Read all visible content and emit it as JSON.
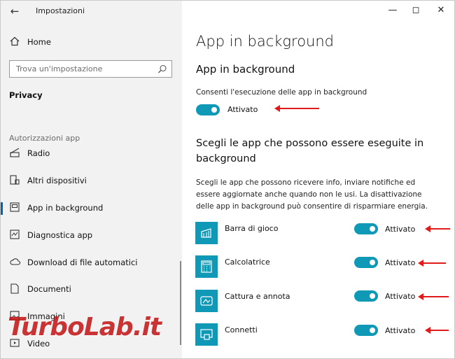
{
  "window": {
    "title": "Impostazioni",
    "minimize_icon": "minimize-icon",
    "maximize_icon": "maximize-icon",
    "close_icon": "close-icon"
  },
  "sidebar": {
    "home": {
      "label": "Home",
      "icon": "home-icon"
    },
    "search": {
      "placeholder": "Trova un'impostazione",
      "icon": "search-icon"
    },
    "section": "Privacy",
    "group_label": "Autorizzazioni app",
    "items": [
      {
        "label": "Radio",
        "icon": "radio-icon"
      },
      {
        "label": "Altri dispositivi",
        "icon": "devices-icon"
      },
      {
        "label": "App in background",
        "icon": "background-apps-icon",
        "active": true
      },
      {
        "label": "Diagnostica app",
        "icon": "diagnostics-icon"
      },
      {
        "label": "Download di file automatici",
        "icon": "cloud-icon"
      },
      {
        "label": "Documenti",
        "icon": "document-icon"
      },
      {
        "label": "Immagini",
        "icon": "image-icon"
      },
      {
        "label": "Video",
        "icon": "video-icon"
      }
    ]
  },
  "main": {
    "page_title": "App in background",
    "section_title": "App in background",
    "allow_label": "Consenti l'esecuzione delle app in background",
    "allow_toggle": {
      "state": "Attivato",
      "on": true
    },
    "choose_title": "Scegli le app che possono essere eseguite in background",
    "choose_desc": "Scegli le app che possono ricevere info, inviare notifiche ed essere aggiornate anche quando non le usi. La disattivazione delle app in background può consentire di risparmiare energia.",
    "apps": [
      {
        "name": "Barra di gioco",
        "state": "Attivato",
        "on": true,
        "icon": "game-bar-icon"
      },
      {
        "name": "Calcolatrice",
        "state": "Attivato",
        "on": true,
        "icon": "calculator-icon"
      },
      {
        "name": "Cattura e annota",
        "state": "Attivato",
        "on": true,
        "icon": "snip-sketch-icon"
      },
      {
        "name": "Connetti",
        "state": "Attivato",
        "on": true,
        "icon": "connect-icon"
      }
    ]
  },
  "colors": {
    "accent": "#0f99b6",
    "arrow": "#e11a1a",
    "sidebar_bg": "#f2f2f2"
  },
  "watermark": "TurboLab.it"
}
